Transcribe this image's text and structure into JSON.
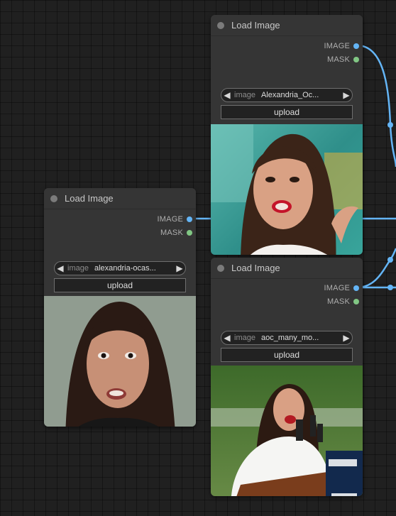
{
  "nodes": [
    {
      "title": "Load Image",
      "outputs": [
        {
          "label": "IMAGE"
        },
        {
          "label": "MASK"
        }
      ],
      "image_widget": {
        "name": "image",
        "value": "Alexandria_Oc..."
      },
      "upload_label": "upload",
      "preview": "photo-woman-speaking-teal-background"
    },
    {
      "title": "Load Image",
      "outputs": [
        {
          "label": "IMAGE"
        },
        {
          "label": "MASK"
        }
      ],
      "image_widget": {
        "name": "image",
        "value": "alexandria-ocas..."
      },
      "upload_label": "upload",
      "preview": "photo-woman-closeup-grey-background"
    },
    {
      "title": "Load Image",
      "outputs": [
        {
          "label": "IMAGE"
        },
        {
          "label": "MASK"
        }
      ],
      "image_widget": {
        "name": "image",
        "value": "aoc_many_mo..."
      },
      "upload_label": "upload",
      "preview": "photo-woman-at-podium-outdoors"
    }
  ],
  "colors": {
    "image_slot": "#64b5f6",
    "mask_slot": "#81c784",
    "link": "#64b5f6",
    "canvas": "#202020",
    "node_bg": "#353535"
  },
  "icons": {
    "combo_left": "◀",
    "combo_right": "▶"
  }
}
